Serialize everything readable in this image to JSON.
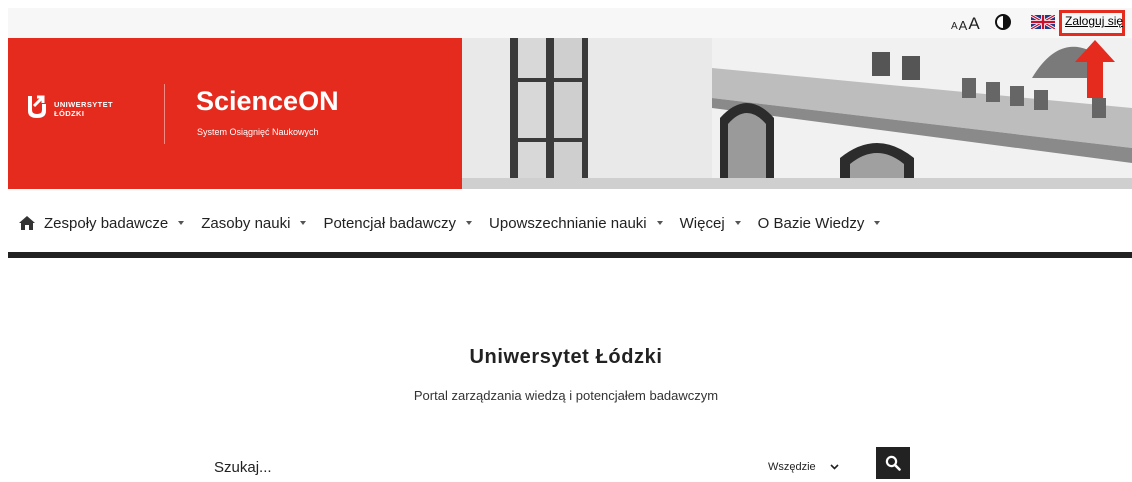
{
  "topbar": {
    "font_size_small": "A",
    "font_size_medium": "A",
    "font_size_large": "A",
    "contrast_icon": "contrast-icon",
    "language_icon": "uk-flag-icon",
    "login_label": "Zaloguj się"
  },
  "banner": {
    "university_line1": "UNIWERSYTET",
    "university_line2": "ŁÓDZKI",
    "brand_title": "ScienceON",
    "brand_subtitle": "System Osiągnięć Naukowych",
    "brand_color": "#e52b1e"
  },
  "nav": {
    "home_icon": "home-icon",
    "items": [
      {
        "label": "Zespoły badawcze"
      },
      {
        "label": "Zasoby nauki"
      },
      {
        "label": "Potencjał badawczy"
      },
      {
        "label": "Upowszechnianie nauki"
      },
      {
        "label": "Więcej"
      },
      {
        "label": "O Bazie Wiedzy"
      }
    ]
  },
  "hero": {
    "title": "Uniwersytet Łódzki",
    "subtitle": "Portal zarządzania wiedzą i potencjałem badawczym"
  },
  "search": {
    "placeholder": "Szukaj...",
    "value": "",
    "scope_selected": "Wszędzie",
    "button_icon": "search-icon"
  },
  "colors": {
    "accent": "#e52b1e",
    "dark": "#222222"
  }
}
